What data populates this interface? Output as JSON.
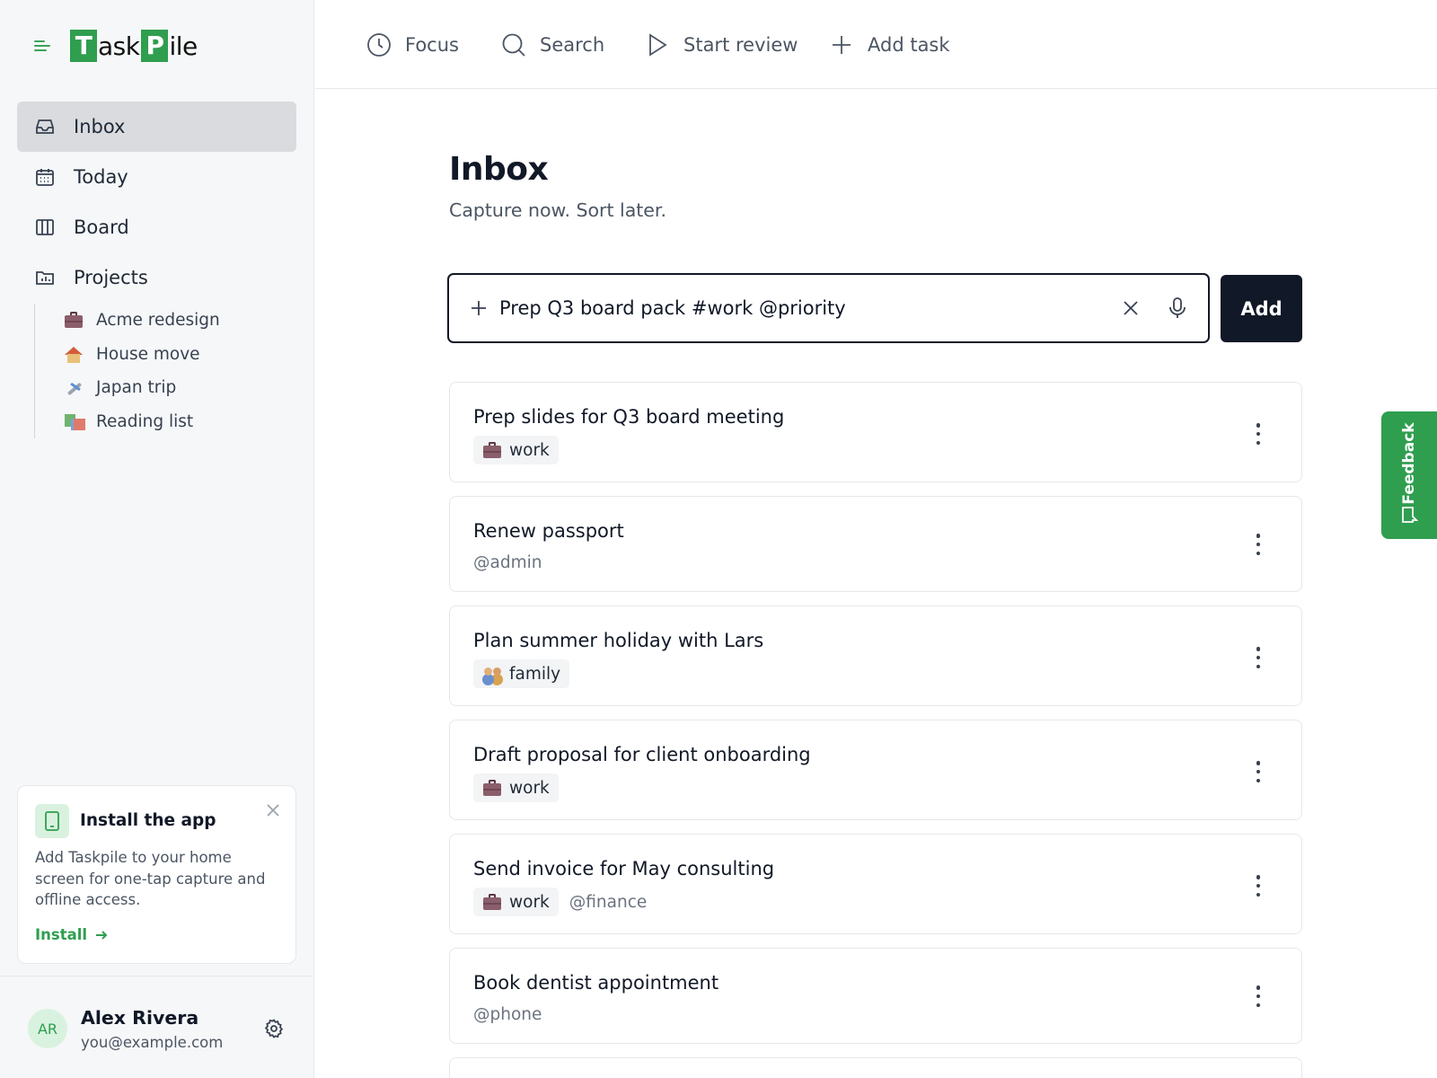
{
  "app": {
    "logo": {
      "t_cap": "T",
      "t_rest": "ask",
      "p_cap": "P",
      "p_rest": "ile"
    }
  },
  "topbar": {
    "items": [
      {
        "label": "Focus",
        "icon": "clock-icon"
      },
      {
        "label": "Search",
        "icon": "search-icon"
      },
      {
        "label": "Start review",
        "icon": "play-icon"
      },
      {
        "label": "Add task",
        "icon": "plus-icon"
      }
    ]
  },
  "sidebar": {
    "nav": [
      {
        "label": "Inbox",
        "icon": "inbox-icon",
        "active": true
      },
      {
        "label": "Today",
        "icon": "calendar-icon"
      },
      {
        "label": "Board",
        "icon": "board-columns-icon"
      },
      {
        "label": "Projects",
        "icon": "folder-icon"
      }
    ],
    "projects": [
      {
        "label": "Acme redesign",
        "icon": "briefcase-emoji"
      },
      {
        "label": "House move",
        "icon": "house-emoji"
      },
      {
        "label": "Japan trip",
        "icon": "airplane-emoji"
      },
      {
        "label": "Reading list",
        "icon": "books-emoji"
      }
    ],
    "install_card": {
      "title": "Install the app",
      "description": "Add Taskpile to your home screen for one-tap capture and offline access.",
      "link": "Install"
    },
    "user": {
      "initials": "AR",
      "name": "Alex Rivera",
      "email": "you@example.com"
    }
  },
  "main": {
    "title": "Inbox",
    "subtitle": "Capture now. Sort later.",
    "capture": {
      "value": "Prep Q3 board pack #work @priority",
      "add_label": "Add"
    },
    "tasks": [
      {
        "title": "Prep slides for Q3 board meeting",
        "tag": "work",
        "tag_icon": "briefcase-emoji",
        "mention": ""
      },
      {
        "title": "Renew passport",
        "tag": "",
        "mention": "@admin"
      },
      {
        "title": "Plan summer holiday with Lars",
        "tag": "family",
        "tag_icon": "family-emoji",
        "mention": ""
      },
      {
        "title": "Draft proposal for client onboarding",
        "tag": "work",
        "tag_icon": "briefcase-emoji",
        "mention": ""
      },
      {
        "title": "Send invoice for May consulting",
        "tag": "work",
        "tag_icon": "briefcase-emoji",
        "mention": "@finance"
      },
      {
        "title": "Book dentist appointment",
        "tag": "",
        "mention": "@phone"
      }
    ]
  },
  "feedback": {
    "label": "Feedback"
  },
  "colors": {
    "brand": "#2f9e4f",
    "primary_button": "#111827",
    "active_nav": "#d9dbde"
  }
}
